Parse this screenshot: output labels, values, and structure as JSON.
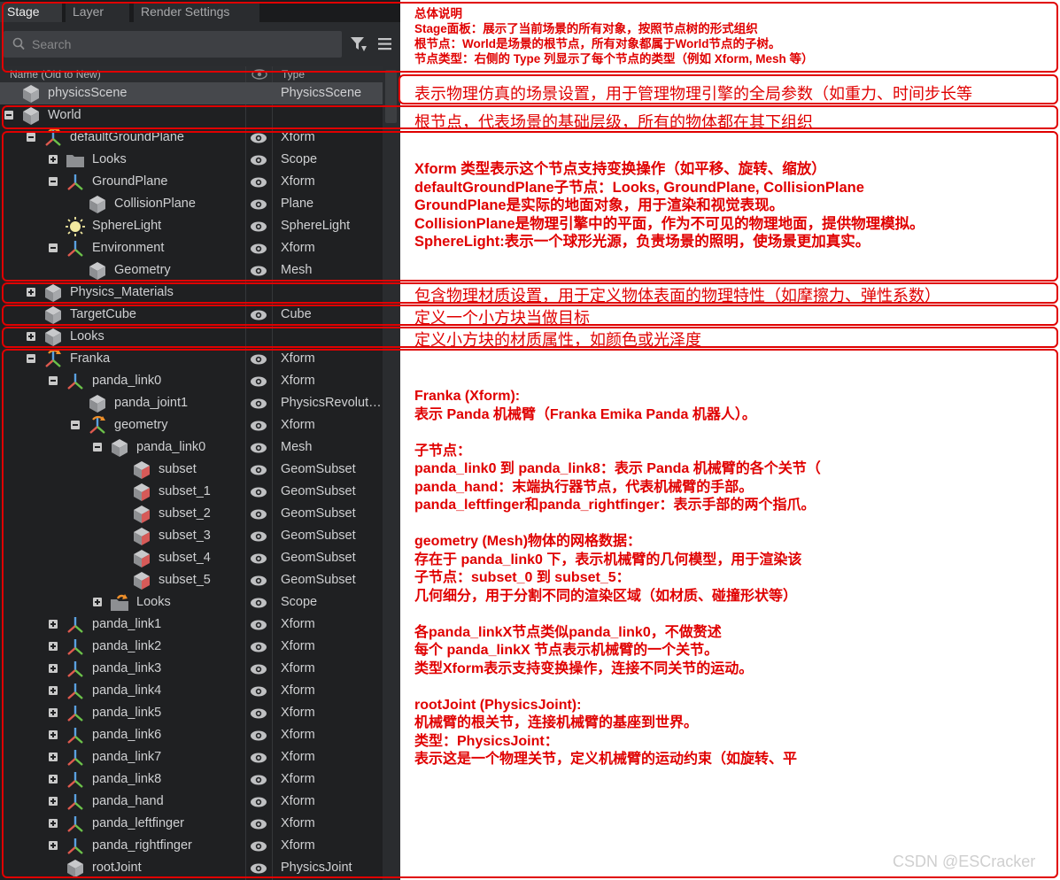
{
  "tabs": [
    {
      "label": "Stage",
      "active": true
    },
    {
      "label": "Layer",
      "active": false
    },
    {
      "label": "Render Settings",
      "active": false
    }
  ],
  "search": {
    "placeholder": "Search"
  },
  "columns": {
    "name": "Name (Old to New)",
    "type": "Type"
  },
  "rows": [
    {
      "name": "physicsScene",
      "type": "PhysicsScene",
      "icon": "cube-icon",
      "depth": 0,
      "expander": "none",
      "eye": false,
      "selected": true
    },
    {
      "name": "World",
      "type": "",
      "icon": "cube-icon",
      "depth": 0,
      "expander": "minus",
      "eye": false
    },
    {
      "name": "defaultGroundPlane",
      "type": "Xform",
      "icon": "xform-icon",
      "depth": 1,
      "expander": "minus",
      "eye": true
    },
    {
      "name": "Looks",
      "type": "Scope",
      "icon": "folder-icon",
      "depth": 2,
      "expander": "plus",
      "eye": true
    },
    {
      "name": "GroundPlane",
      "type": "Xform",
      "icon": "axes-icon",
      "depth": 2,
      "expander": "minus",
      "eye": true
    },
    {
      "name": "CollisionPlane",
      "type": "Plane",
      "icon": "cube-icon",
      "depth": 3,
      "expander": "none",
      "eye": true
    },
    {
      "name": "SphereLight",
      "type": "SphereLight",
      "icon": "light-icon",
      "depth": 2,
      "expander": "none",
      "eye": true
    },
    {
      "name": "Environment",
      "type": "Xform",
      "icon": "axes-icon",
      "depth": 2,
      "expander": "minus",
      "eye": true
    },
    {
      "name": "Geometry",
      "type": "Mesh",
      "icon": "cube-icon",
      "depth": 3,
      "expander": "none",
      "eye": true
    },
    {
      "name": "Physics_Materials",
      "type": "",
      "icon": "cube-icon",
      "depth": 1,
      "expander": "plus",
      "eye": false
    },
    {
      "name": "TargetCube",
      "type": "Cube",
      "icon": "cube-icon",
      "depth": 1,
      "expander": "none",
      "eye": true
    },
    {
      "name": "Looks",
      "type": "",
      "icon": "cube-icon",
      "depth": 1,
      "expander": "plus",
      "eye": false
    },
    {
      "name": "Franka",
      "type": "Xform",
      "icon": "xform-icon",
      "depth": 1,
      "expander": "minus",
      "eye": true
    },
    {
      "name": "panda_link0",
      "type": "Xform",
      "icon": "axes-icon",
      "depth": 2,
      "expander": "minus",
      "eye": true
    },
    {
      "name": "panda_joint1",
      "type": "PhysicsRevoluteJoint",
      "icon": "cube-icon",
      "depth": 3,
      "expander": "none",
      "eye": true
    },
    {
      "name": "geometry",
      "type": "Xform",
      "icon": "xform-icon",
      "depth": 3,
      "expander": "minus",
      "eye": true
    },
    {
      "name": "panda_link0",
      "type": "Mesh",
      "icon": "cube-icon",
      "depth": 4,
      "expander": "minus",
      "eye": true
    },
    {
      "name": "subset",
      "type": "GeomSubset",
      "icon": "subset-icon",
      "depth": 5,
      "expander": "none",
      "eye": true
    },
    {
      "name": "subset_1",
      "type": "GeomSubset",
      "icon": "subset-icon",
      "depth": 5,
      "expander": "none",
      "eye": true
    },
    {
      "name": "subset_2",
      "type": "GeomSubset",
      "icon": "subset-icon",
      "depth": 5,
      "expander": "none",
      "eye": true
    },
    {
      "name": "subset_3",
      "type": "GeomSubset",
      "icon": "subset-icon",
      "depth": 5,
      "expander": "none",
      "eye": true
    },
    {
      "name": "subset_4",
      "type": "GeomSubset",
      "icon": "subset-icon",
      "depth": 5,
      "expander": "none",
      "eye": true
    },
    {
      "name": "subset_5",
      "type": "GeomSubset",
      "icon": "subset-icon",
      "depth": 5,
      "expander": "none",
      "eye": true
    },
    {
      "name": "Looks",
      "type": "Scope",
      "icon": "folder-orange-icon",
      "depth": 4,
      "expander": "plus",
      "eye": true
    },
    {
      "name": "panda_link1",
      "type": "Xform",
      "icon": "axes-icon",
      "depth": 2,
      "expander": "plus",
      "eye": true
    },
    {
      "name": "panda_link2",
      "type": "Xform",
      "icon": "axes-icon",
      "depth": 2,
      "expander": "plus",
      "eye": true
    },
    {
      "name": "panda_link3",
      "type": "Xform",
      "icon": "axes-icon",
      "depth": 2,
      "expander": "plus",
      "eye": true
    },
    {
      "name": "panda_link4",
      "type": "Xform",
      "icon": "axes-icon",
      "depth": 2,
      "expander": "plus",
      "eye": true
    },
    {
      "name": "panda_link5",
      "type": "Xform",
      "icon": "axes-icon",
      "depth": 2,
      "expander": "plus",
      "eye": true
    },
    {
      "name": "panda_link6",
      "type": "Xform",
      "icon": "axes-icon",
      "depth": 2,
      "expander": "plus",
      "eye": true
    },
    {
      "name": "panda_link7",
      "type": "Xform",
      "icon": "axes-icon",
      "depth": 2,
      "expander": "plus",
      "eye": true
    },
    {
      "name": "panda_link8",
      "type": "Xform",
      "icon": "axes-icon",
      "depth": 2,
      "expander": "plus",
      "eye": true
    },
    {
      "name": "panda_hand",
      "type": "Xform",
      "icon": "axes-icon",
      "depth": 2,
      "expander": "plus",
      "eye": true
    },
    {
      "name": "panda_leftfinger",
      "type": "Xform",
      "icon": "axes-icon",
      "depth": 2,
      "expander": "plus",
      "eye": true
    },
    {
      "name": "panda_rightfinger",
      "type": "Xform",
      "icon": "axes-icon",
      "depth": 2,
      "expander": "plus",
      "eye": true
    },
    {
      "name": "rootJoint",
      "type": "PhysicsJoint",
      "icon": "cube-icon",
      "depth": 2,
      "expander": "none",
      "eye": true
    }
  ],
  "annotations": {
    "overview": [
      "总体说明",
      "Stage面板：展示了当前场景的所有对象，按照节点树的形式组织",
      "根节点：World是场景的根节点，所有对象都属于World节点的子树。",
      "节点类型：右侧的 Type 列显示了每个节点的类型（例如 Xform, Mesh 等）"
    ],
    "physics_scene": "表示物理仿真的场景设置，用于管理物理引擎的全局参数（如重力、时间步长等",
    "world": "根节点，代表场景的基础层级，所有的物体都在其下组织",
    "ground": [
      "Xform 类型表示这个节点支持变换操作（如平移、旋转、缩放）",
      "defaultGroundPlane子节点：Looks, GroundPlane, CollisionPlane",
      "GroundPlane是实际的地面对象，用于渲染和视觉表现。",
      "CollisionPlane是物理引擎中的平面，作为不可见的物理地面，提供物理模拟。",
      "SphereLight:表示一个球形光源，负责场景的照明，使场景更加真实。"
    ],
    "physics_materials": "包含物理材质设置，用于定义物体表面的物理特性（如摩擦力、弹性系数）",
    "target_cube": "定义一个小方块当做目标",
    "looks": "定义小方块的材质属性，如颜色或光泽度",
    "franka": [
      "Franka (Xform):",
      "表示 Panda 机械臂（Franka Emika Panda 机器人）。",
      "",
      "子节点：",
      "panda_link0 到 panda_link8：表示 Panda 机械臂的各个关节（",
      "panda_hand：末端执行器节点，代表机械臂的手部。",
      "panda_leftfinger和panda_rightfinger：表示手部的两个指爪。",
      "",
      "geometry (Mesh)物体的网格数据：",
      "存在于 panda_link0 下，表示机械臂的几何模型，用于渲染该",
      "子节点：subset_0 到 subset_5：",
      "几何细分，用于分割不同的渲染区域（如材质、碰撞形状等）",
      "",
      "各panda_linkX节点类似panda_link0，不做赘述",
      "每个 panda_linkX 节点表示机械臂的一个关节。",
      "类型Xform表示支持变换操作，连接不同关节的运动。",
      "",
      "rootJoint (PhysicsJoint):",
      "机械臂的根关节，连接机械臂的基座到世界。",
      "类型：PhysicsJoint：",
      "表示这是一个物理关节，定义机械臂的运动约束（如旋转、平"
    ]
  },
  "watermark": "CSDN @ESCracker",
  "colors": {
    "annotation": "#e00000",
    "panel_bg": "#1f2022",
    "selected_row": "#46484c",
    "text": "#cfd0d2"
  }
}
